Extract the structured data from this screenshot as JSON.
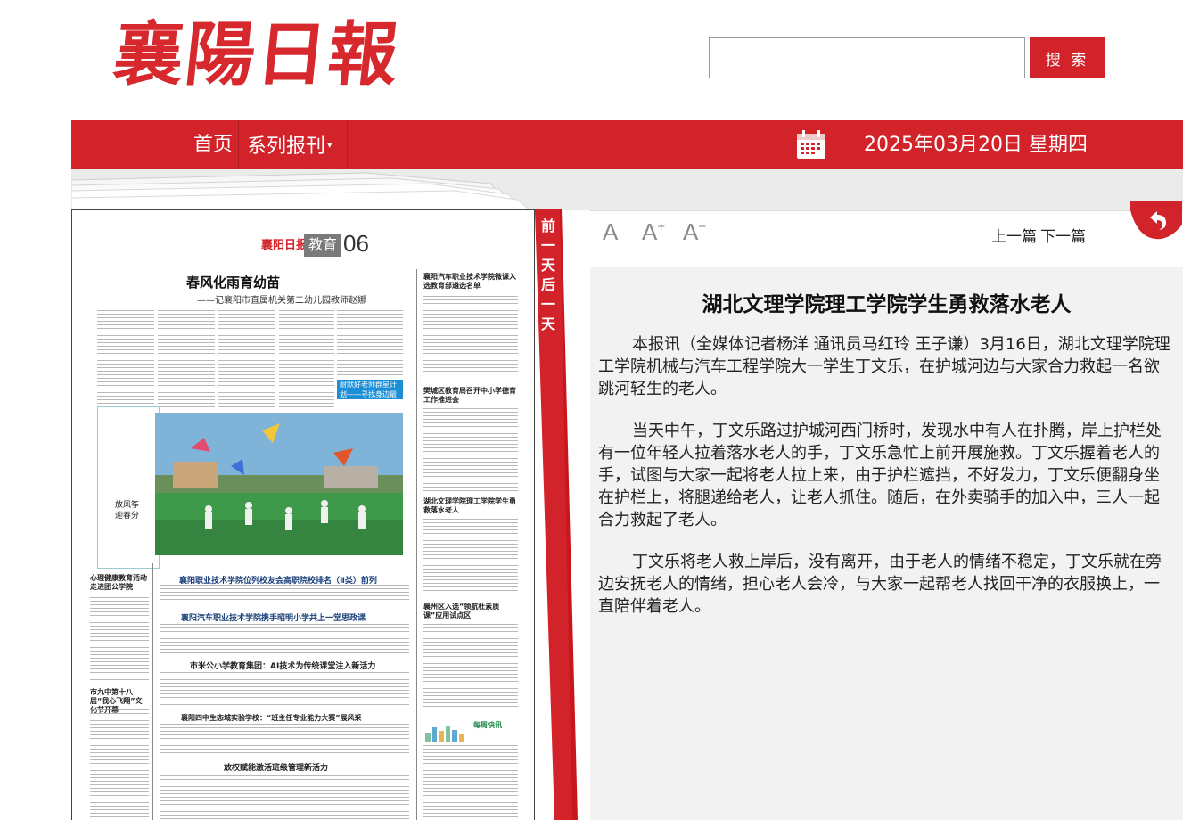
{
  "header": {
    "logo_text": "襄陽日報",
    "search_placeholder": "",
    "search_button": "搜 索"
  },
  "nav": {
    "home": "首页",
    "series": "系列报刊",
    "date": "2025年03月20日 星期四"
  },
  "paper": {
    "masthead": "襄阳日报",
    "section": "教育",
    "page_number": "06",
    "title": "春风化雨育幼苗",
    "subtitle": "——记襄阳市直属机关第二幼儿园教师赵娜",
    "photo_caption": "放风筝\n迎春分",
    "blue_box_text": "耐默好老师群星计划——寻找身边最美教师",
    "headlines": [
      "襄阳职业技术学院位列校友会高职院校排名（Ⅱ类）前列",
      "襄阳汽车职业技术学院携手昭明小学共上一堂思政课",
      "市米公小学教育集团：AI技术为传统课堂注入新活力",
      "襄阳四中生态城实验学校：“班主任专业能力大赛”展风采",
      "放权赋能激活班级管理新活力",
      "襄阳汽车职业技术学院微课入选教育部遴选名单",
      "樊城区教育局召开中小学德育工作推进会",
      "湖北文理学院理工学院学生勇救落水老人",
      "襄州区入选“领航杜素质课”应用试点区",
      "每周快讯",
      "心理健康教育活动走进团公学院",
      "市九中第十八届“我心飞翔”文化节开幕"
    ]
  },
  "turn_tab": {
    "prev_day": "前一天",
    "next_day": "后一天"
  },
  "toolbar": {
    "font_normal": "A",
    "font_larger": "A",
    "font_smaller": "A",
    "prev_article": "上一篇",
    "next_article": "下一篇"
  },
  "article": {
    "title": "湖北文理学院理工学院学生勇救落水老人",
    "paragraphs": [
      "本报讯（全媒体记者杨洋 通讯员马红玲 王子谦）3月16日，湖北文理学院理工学院机械与汽车工程学院大一学生丁文乐，在护城河边与大家合力救起一名欲跳河轻生的老人。",
      "当天中午，丁文乐路过护城河西门桥时，发现水中有人在扑腾，岸上护栏处有一位年轻人拉着落水老人的手，丁文乐急忙上前开展施救。丁文乐握着老人的手，试图与大家一起将老人拉上来，由于护栏遮挡，不好发力，丁文乐便翻身坐在护栏上，将腿递给老人，让老人抓住。随后，在外卖骑手的加入中，三人一起合力救起了老人。",
      "丁文乐将老人救上岸后，没有离开，由于老人的情绪不稳定，丁文乐就在旁边安抚老人的情绪，担心老人会冷，与大家一起帮老人找回干净的衣服换上，一直陪伴着老人。"
    ]
  },
  "colors": {
    "brand_red": "#d2232a",
    "nav_text": "#ffffff",
    "article_bg": "#f2f2f2"
  },
  "icons": [
    "calendar-icon",
    "back-arrow-icon"
  ]
}
